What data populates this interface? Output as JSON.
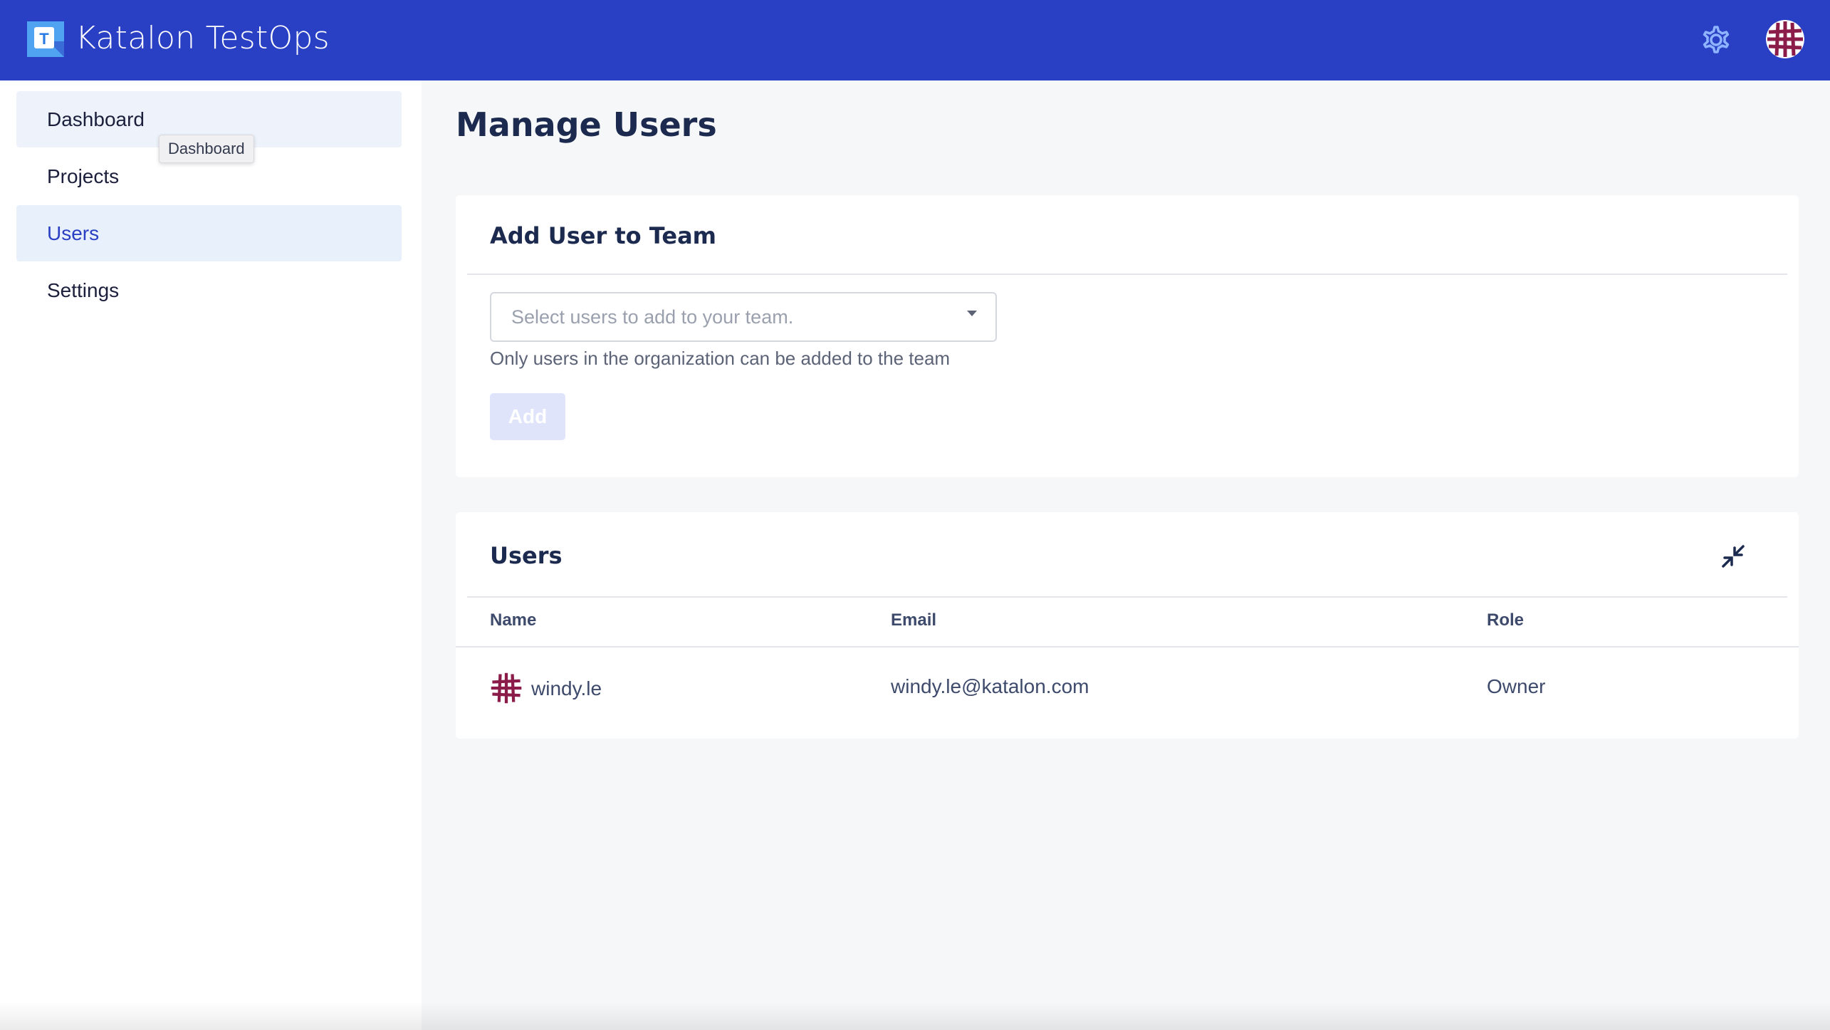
{
  "app": {
    "brand": "Katalon TestOps",
    "colors": {
      "topbar": "#2a40c4",
      "accent": "#2a40c4",
      "avatar": "#8b1c4a"
    },
    "icons": {
      "logo": "katalon-logo-icon",
      "settings": "gear-icon",
      "profile": "avatar"
    }
  },
  "sidebar": {
    "items": [
      {
        "label": "Dashboard",
        "state": "hover"
      },
      {
        "label": "Projects",
        "state": "default"
      },
      {
        "label": "Users",
        "state": "active"
      },
      {
        "label": "Settings",
        "state": "default"
      }
    ],
    "tooltip": "Dashboard"
  },
  "main": {
    "title": "Manage Users",
    "add_card": {
      "title": "Add User to Team",
      "select_placeholder": "Select users to add to your team.",
      "hint": "Only users in the organization can be added to the team",
      "add_label": "Add"
    },
    "users_card": {
      "title": "Users",
      "columns": [
        "Name",
        "Email",
        "Role"
      ],
      "rows": [
        {
          "name": "windy.le",
          "email": "windy.le@katalon.com",
          "role": "Owner"
        }
      ]
    }
  }
}
